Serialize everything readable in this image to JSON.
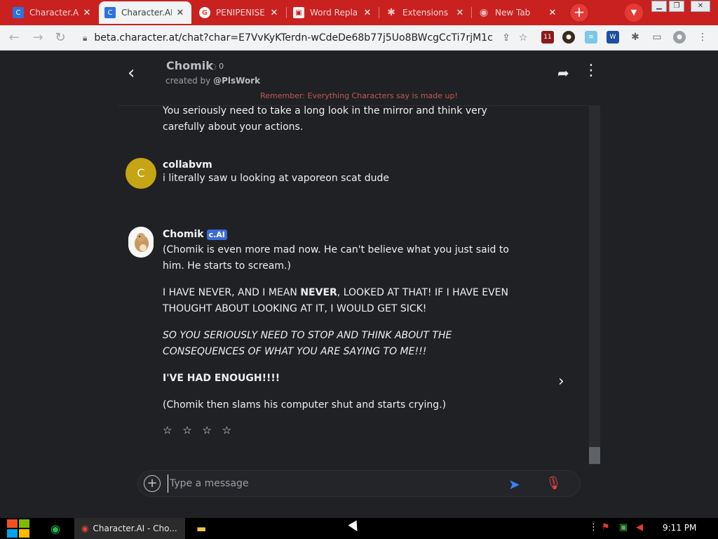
{
  "browser": {
    "tabs": [
      {
        "title": "Character.AI",
        "icon": "character-ai-icon"
      },
      {
        "title": "Character.AI",
        "icon": "character-ai-icon"
      },
      {
        "title": "PENIPENISE",
        "icon": "google-icon"
      },
      {
        "title": "Word Repla",
        "icon": "word-replacer-icon"
      },
      {
        "title": "Extensions",
        "icon": "puzzle-icon"
      },
      {
        "title": "New Tab",
        "icon": "chrome-icon"
      }
    ],
    "close_glyph": "✕",
    "new_tab_glyph": "+",
    "url": "beta.character.at/chat?char=E7VvKyKTerdn-wCdeDe68b77j5Uo8BWcgCcTi7rjM1c",
    "extension_badge": "11"
  },
  "chat": {
    "character_name": "Chomik",
    "interaction_count": "0",
    "created_by_prefix": "created by",
    "creator_handle": "@PlsWork",
    "reminder": "Remember: Everything Characters say is made up!",
    "messages": [
      {
        "author": "",
        "lines": [
          "You seriously need to take a long look in the mirror and think very carefully about your actions."
        ]
      },
      {
        "author": "collabvm",
        "avatar_letter": "C",
        "avatar_color": "#c6a514",
        "text": "i literally saw u looking at vaporeon scat dude"
      },
      {
        "author": "Chomik",
        "badge": "c.AI",
        "p1": "(Chomik is even more mad now. He can't believe what you just said to him. He starts to scream.)",
        "p2_pre": "I HAVE NEVER, AND I MEAN ",
        "p2_bold": "NEVER",
        "p2_post": ", LOOKED AT THAT! IF I HAVE EVEN THOUGHT ABOUT LOOKING AT IT, I WOULD GET SICK!",
        "p3": "SO YOU SERIOUSLY NEED TO STOP AND THINK ABOUT THE CONSEQUENCES OF WHAT YOU ARE SAYING TO ME!!!",
        "p4": "I'VE HAD ENOUGH!!!!",
        "p5": "(Chomik then slams his computer shut and starts crying.)",
        "rating_stars": "☆ ☆ ☆ ☆"
      }
    ],
    "input_placeholder": "Type a message"
  },
  "taskbar": {
    "app_title": "Character.AI - Cho...",
    "time": "9:11 PM"
  },
  "colors": {
    "tabstrip": "#c8211f",
    "accent_blue": "#3b82f6",
    "mic_red": "#e04545",
    "badge_blue": "#3b6bd6"
  }
}
